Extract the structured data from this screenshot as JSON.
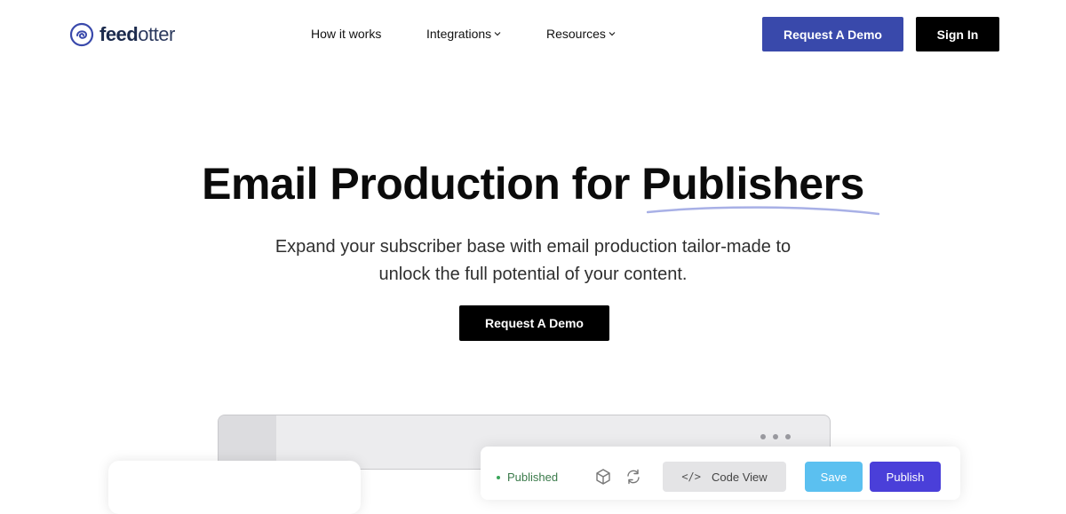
{
  "brand": {
    "name_part1": "feed",
    "name_part2": "otter",
    "logo_color": "#3949ab"
  },
  "nav": {
    "items": [
      {
        "label": "How it works"
      },
      {
        "label": "Integrations",
        "icon": "chevron-down-icon"
      },
      {
        "label": "Resources",
        "icon": "chevron-down-icon"
      }
    ],
    "demo_label": "Request A Demo",
    "signin_label": "Sign In"
  },
  "hero": {
    "title_main": "Email Production for ",
    "title_highlight": "Publishers",
    "subtitle_line1": "Expand your subscriber base with email production tailor-made to",
    "subtitle_line2": "unlock the full potential of your content.",
    "cta_label": "Request A Demo"
  },
  "editor": {
    "status_label": "Published",
    "code_view_label": "Code View",
    "code_icon_glyph": "</>",
    "save_label": "Save",
    "publish_label": "Publish"
  },
  "colors": {
    "primary": "#3949ab",
    "black": "#000000",
    "save": "#5bc0f0",
    "publish": "#4a3fd9",
    "status_green": "#3aa55a",
    "underline": "#a8b0e6"
  },
  "icons": {
    "logo": "feedotter-logo-icon",
    "cube": "cube-icon",
    "refresh": "refresh-icon",
    "more": "more-dots-icon"
  }
}
